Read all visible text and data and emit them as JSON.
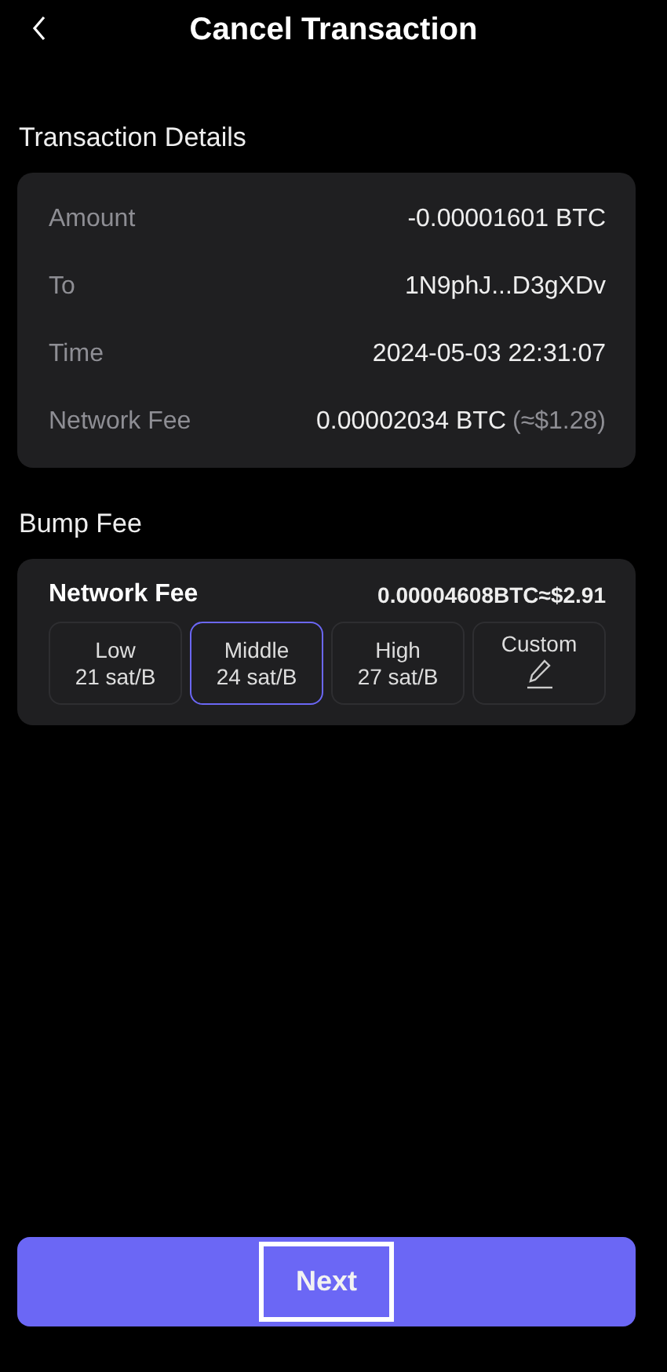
{
  "header": {
    "title": "Cancel Transaction"
  },
  "details": {
    "title": "Transaction Details",
    "rows": [
      {
        "label": "Amount",
        "value": "-0.00001601 BTC"
      },
      {
        "label": "To",
        "value": "1N9phJ...D3gXDv"
      },
      {
        "label": "Time",
        "value": "2024-05-03 22:31:07"
      },
      {
        "label": "Network Fee",
        "value": "0.00002034 BTC",
        "note": "(≈$1.28)"
      }
    ]
  },
  "bump": {
    "title": "Bump Fee",
    "fee_label": "Network Fee",
    "fee_value": "0.00004608BTC≈$2.91",
    "options": [
      {
        "kind": "preset",
        "name": "Low",
        "rate": "21 sat/B",
        "selected": false
      },
      {
        "kind": "preset",
        "name": "Middle",
        "rate": "24 sat/B",
        "selected": true
      },
      {
        "kind": "preset",
        "name": "High",
        "rate": "27 sat/B",
        "selected": false
      },
      {
        "kind": "custom",
        "name": "Custom",
        "selected": false
      }
    ]
  },
  "next_button": {
    "label": "Next",
    "focused": true
  }
}
